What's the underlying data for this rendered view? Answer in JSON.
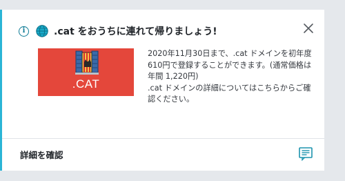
{
  "notification": {
    "title": ".cat をおうちに連れて帰りましょう!",
    "banner_text": ".CAT",
    "description": "2020年11月30日まで、.cat ドメインを初年度610円で登録することができます。(通常価格は年間 1,220円)\n.cat ドメインの詳細についてはこちらからご確認ください。",
    "details_label": "詳細を確認"
  },
  "colors": {
    "accent": "#2bb5d6",
    "banner": "#e4473b",
    "icon_teal": "#0c7a95"
  },
  "icons": {
    "info": "info-icon",
    "globe": "globe-icon",
    "close": "close-icon",
    "doc": "document-icon"
  }
}
